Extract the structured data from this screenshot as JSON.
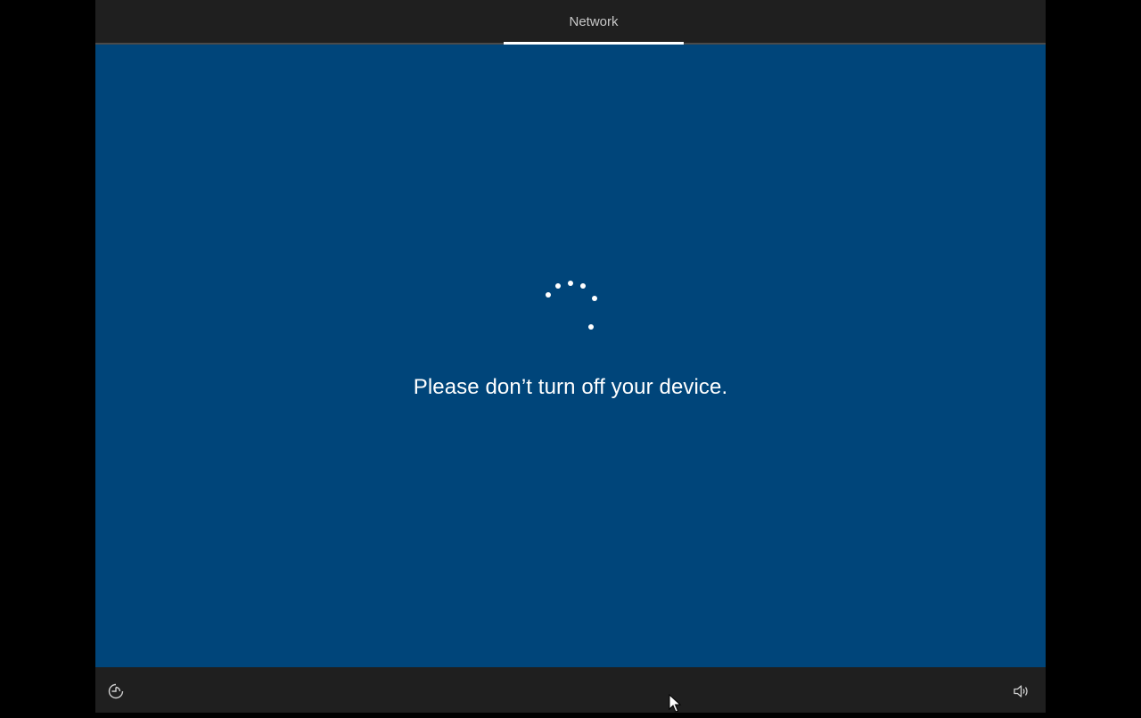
{
  "header": {
    "tab_label": "Network"
  },
  "main": {
    "message": "Please don’t turn off your device.",
    "spinner_icon": "loading-dots-icon"
  },
  "footer": {
    "ease_of_access_icon": "ease-of-access-icon",
    "volume_icon": "volume-icon"
  },
  "colors": {
    "background": "#000000",
    "bar": "#1f1f1f",
    "main": "#00457a",
    "text": "#ffffff",
    "tab_text": "#c8c8c8"
  }
}
